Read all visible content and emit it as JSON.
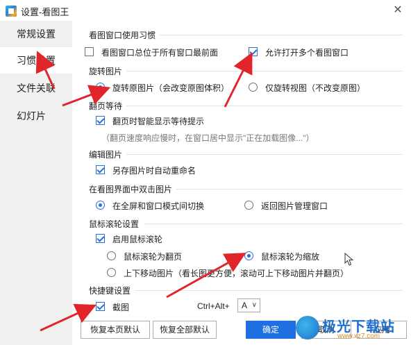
{
  "window": {
    "title": "设置-看图王",
    "close_glyph": "✕"
  },
  "sidebar": {
    "items": [
      {
        "label": "常规设置"
      },
      {
        "label": "习惯设置"
      },
      {
        "label": "文件关联"
      },
      {
        "label": "幻灯片"
      }
    ]
  },
  "sections": {
    "window_habit": {
      "title": "看图窗口使用习惯",
      "always_on_top": {
        "label": "看图窗口总位于所有窗口最前面",
        "checked": false
      },
      "multi_window": {
        "label": "允许打开多个看图窗口",
        "checked": true
      }
    },
    "rotate": {
      "title": "旋转图片",
      "rotate_original": {
        "label": "旋转原图片（会改变原图体积）",
        "checked": true
      },
      "rotate_view": {
        "label": "仅旋转视图（不改变原图）",
        "checked": false
      }
    },
    "page_wait": {
      "title": "翻页等待",
      "smart_wait": {
        "label": "翻页时智能显示等待提示",
        "checked": true
      },
      "hint": "（翻页速度响应慢时，在窗口居中显示\"正在加载图像...\"）"
    },
    "edit": {
      "title": "编辑图片",
      "auto_rename": {
        "label": "另存图片时自动重命名",
        "checked": true
      }
    },
    "double_click": {
      "title": "在看图界面中双击图片",
      "toggle_fullscreen": {
        "label": "在全屏和窗口模式间切换",
        "checked": true
      },
      "back_to_manager": {
        "label": "返回图片管理窗口",
        "checked": false
      }
    },
    "wheel": {
      "title": "鼠标滚轮设置",
      "enable_wheel": {
        "label": "启用鼠标滚轮",
        "checked": true
      },
      "wheel_page": {
        "label": "鼠标滚轮为翻页",
        "checked": false
      },
      "wheel_zoom": {
        "label": "鼠标滚轮为缩放",
        "checked": true
      },
      "scroll_move": {
        "label": "上下移动图片（看长图更方便，滚动可上下移动图片并翻页）",
        "checked": false
      }
    },
    "hotkey": {
      "title": "快捷键设置",
      "screenshot": {
        "label": "截图",
        "checked": true
      },
      "combo_label": "Ctrl+Alt+",
      "key_value": "A"
    }
  },
  "buttons": {
    "restore_page": "恢复本页默认",
    "restore_all": "恢复全部默认",
    "ok": "确定",
    "cancel": "取消",
    "apply": "应用"
  },
  "watermark": {
    "brand": "极光下载站",
    "url": "www.xz7.com"
  },
  "colors": {
    "accent": "#1e6fe0",
    "annotation_arrow": "#e0262a",
    "sidebar_bg": "#f0f0f0"
  }
}
